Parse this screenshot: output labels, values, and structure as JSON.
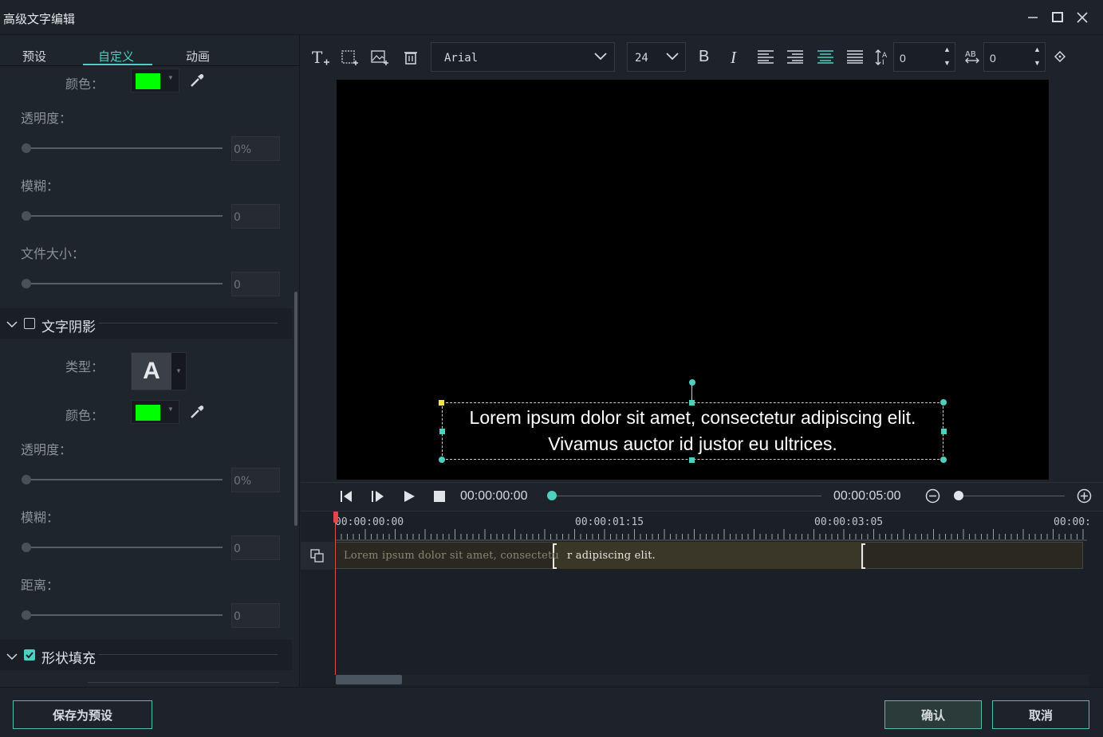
{
  "window": {
    "title": "高级文字编辑",
    "minimize_icon": "minimize-icon",
    "maximize_icon": "maximize-icon",
    "close_icon": "close-icon"
  },
  "tabs": [
    {
      "label": "预设"
    },
    {
      "label": "自定义",
      "active": true
    },
    {
      "label": "动画"
    }
  ],
  "fill_section": {
    "color_label": "颜色：",
    "color_value": "#00ff00",
    "opacity_label": "透明度：",
    "opacity_value": "0%",
    "blur_label": "模糊：",
    "blur_value": "0",
    "size_label": "文件大小：",
    "size_value": "0"
  },
  "shadow_section": {
    "title": "文字阴影",
    "checked": false,
    "type_label": "类型：",
    "type_glyph": "A",
    "color_label": "颜色：",
    "color_value": "#00ff00",
    "opacity_label": "透明度：",
    "opacity_value": "0%",
    "blur_label": "模糊：",
    "blur_value": "0",
    "distance_label": "距离：",
    "distance_value": "0"
  },
  "shape_fill_section": {
    "title": "形状填充",
    "checked": true
  },
  "toolbar": {
    "font_family": "Arial",
    "font_size": "24",
    "bold_label": "B",
    "italic_label": "I",
    "line_spacing_value": "0",
    "char_spacing_value": "0"
  },
  "preview": {
    "caption_line1": "Lorem ipsum dolor sit amet, consectetur adipiscing elit.",
    "caption_line2": "Vivamus auctor id justor eu ultrices."
  },
  "playback": {
    "current_time": "00:00:00:00",
    "total_time": "00:00:05:00"
  },
  "timeline": {
    "ruler_labels": [
      "00:00:00:00",
      "00:00:01:15",
      "00:00:03:05",
      "00:00:"
    ],
    "clip_text_dim": "Lorem ipsum dolor sit amet, consectetu",
    "clip_text_bright": "r adipiscing elit."
  },
  "buttons": {
    "save_preset": "保存为预设",
    "confirm": "确认",
    "cancel": "取消"
  },
  "colors": {
    "accent": "#4ed0c0",
    "background": "#1e232b",
    "playhead": "#e05050"
  }
}
